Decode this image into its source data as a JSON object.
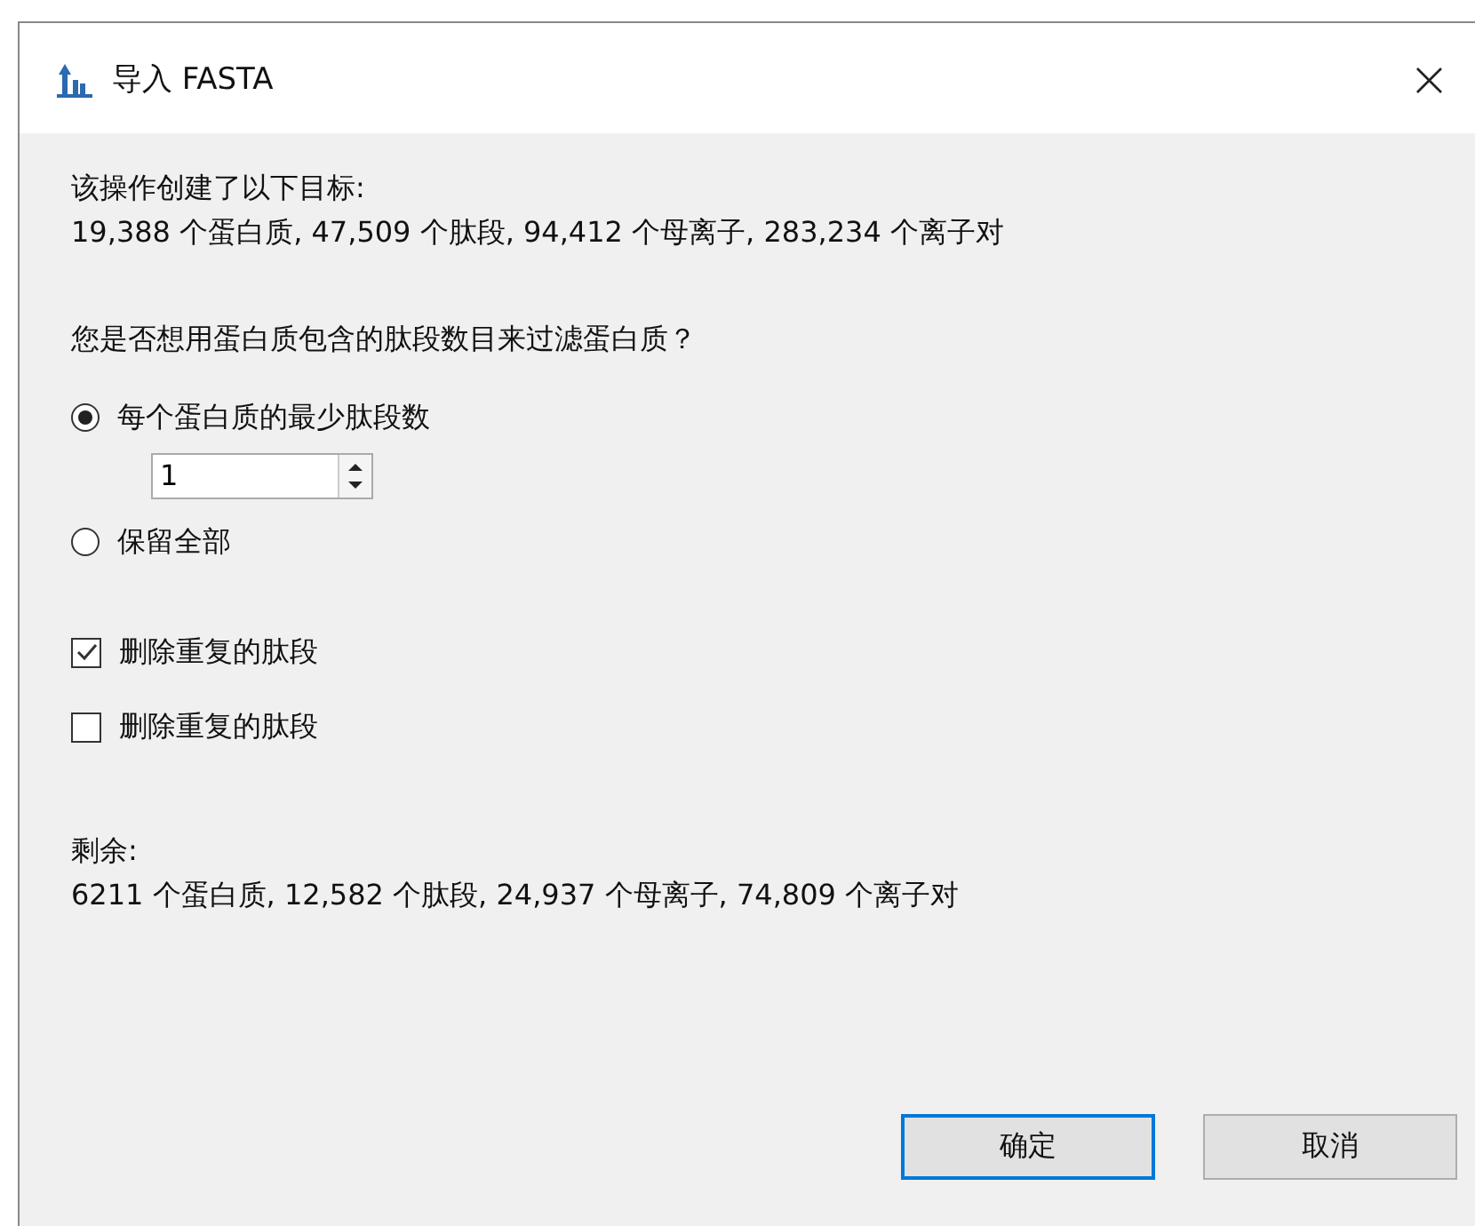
{
  "window": {
    "title": "导入 FASTA",
    "close": "×"
  },
  "summary": {
    "heading": "该操作创建了以下目标:",
    "text": "19,388 个蛋白质, 47,509 个肽段, 94,412 个母离子, 283,234 个离子对"
  },
  "question": "您是否想用蛋白质包含的肽段数目来过滤蛋白质？",
  "options": [
    {
      "label": "每个蛋白质的最少肽段数",
      "selected": true,
      "spin_value": "1"
    },
    {
      "label": "保留全部",
      "selected": false
    }
  ],
  "checkboxes": [
    {
      "label": "删除重复的肽段",
      "checked": true
    },
    {
      "label": "删除重复的肽段",
      "checked": false
    }
  ],
  "remaining": {
    "heading": "剩余:",
    "text": "6211 个蛋白质, 12,582 个肽段, 24,937 个母离子, 74,809 个离子对"
  },
  "buttons": [
    {
      "label": "确定",
      "default": true
    },
    {
      "label": "取消",
      "default": false
    }
  ]
}
